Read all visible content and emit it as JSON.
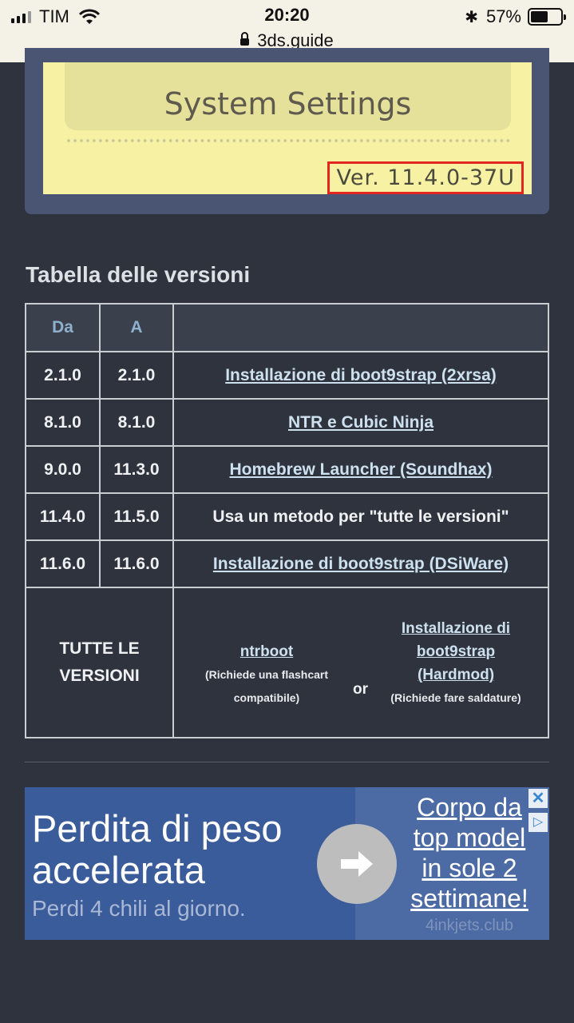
{
  "status_bar": {
    "carrier": "TIM",
    "time": "20:20",
    "battery_percent_label": "57%",
    "battery_level": 0.57,
    "url": "3ds.guide"
  },
  "screenshot_image": {
    "settings_label": "System Settings",
    "version_label": "Ver. 11.4.0-37U"
  },
  "section": {
    "title": "Tabella delle versioni"
  },
  "table": {
    "headers": [
      "Da",
      "A",
      ""
    ],
    "rows": [
      {
        "from": "2.1.0",
        "to": "2.1.0",
        "method": "Installazione di boot9strap (2xrsa)",
        "is_link": true
      },
      {
        "from": "8.1.0",
        "to": "8.1.0",
        "method": "NTR e Cubic Ninja",
        "is_link": true
      },
      {
        "from": "9.0.0",
        "to": "11.3.0",
        "method": "Homebrew Launcher (Soundhax)",
        "is_link": true
      },
      {
        "from": "11.4.0",
        "to": "11.5.0",
        "method": "Usa un metodo per \"tutte le versioni\"",
        "is_link": false
      },
      {
        "from": "11.6.0",
        "to": "11.6.0",
        "method": "Installazione di boot9strap (DSiWare)",
        "is_link": true
      }
    ],
    "all_versions": {
      "label_line1": "TUTTE LE",
      "label_line2": "VERSIONI",
      "option1_link": "ntrboot",
      "option1_note_line1": "(Richiede una flashcart",
      "option1_note_line2": "compatibile)",
      "or_label": "or",
      "option2_link_line1": "Installazione di",
      "option2_link_line2": "boot9strap",
      "option2_link_line3": "(Hardmod)",
      "option2_note": "(Richiede fare saldature)"
    }
  },
  "ad": {
    "headline_line1": "Perdita di peso",
    "headline_line2": "accelerata",
    "subline": "Perdi 4 chili al giorno.",
    "promo_line1": "Corpo da",
    "promo_line2": "top model",
    "promo_line3": "in sole 2",
    "promo_line4": "settimane!",
    "domain": "4inkjets.club",
    "close_glyph": "✕",
    "choices_glyph": "▷",
    "colors": {
      "background": "#3a5c9a",
      "text": "#ffffff"
    }
  },
  "icons": [
    "signal-icon",
    "wifi-icon",
    "bluetooth-icon",
    "battery-icon",
    "lock-icon",
    "arrow-right-icon",
    "close-icon",
    "adchoices-icon"
  ]
}
